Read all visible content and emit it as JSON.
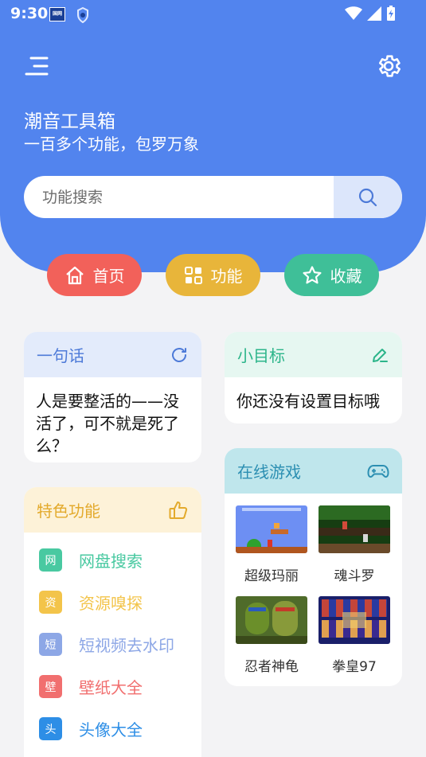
{
  "status": {
    "time": "9:30",
    "sim_label": "国网"
  },
  "header": {
    "title": "潮音工具箱",
    "subtitle": "一百多个功能，包罗万象"
  },
  "search": {
    "placeholder": "功能搜索"
  },
  "nav": [
    {
      "label": "首页",
      "icon": "home-icon",
      "color": "#f2615a"
    },
    {
      "label": "功能",
      "icon": "grid-icon",
      "color": "#e8b53a"
    },
    {
      "label": "收藏",
      "icon": "star-icon",
      "color": "#3fbf98"
    }
  ],
  "quote": {
    "title": "一句话",
    "text": "人是要整活的——没活了，可不就是死了么？",
    "accent": "#4d7ad8",
    "head_bg": "#e3ebfb"
  },
  "goal": {
    "title": "小目标",
    "text": "你还没有设置目标哦",
    "accent": "#2cb58a",
    "head_bg": "#e6f7f1"
  },
  "features": {
    "title": "特色功能",
    "accent": "#e3aa2c",
    "head_bg": "#fdf2d8",
    "items": [
      {
        "badge": "网",
        "label": "网盘搜索",
        "color": "#49c9a1"
      },
      {
        "badge": "资",
        "label": "资源嗅探",
        "color": "#f3c44a"
      },
      {
        "badge": "短",
        "label": "短视频去水印",
        "color": "#8da7e6"
      },
      {
        "badge": "壁",
        "label": "壁纸大全",
        "color": "#f16f6f"
      },
      {
        "badge": "头",
        "label": "头像大全",
        "color": "#2d8ee6"
      }
    ]
  },
  "games": {
    "title": "在线游戏",
    "accent": "#2c8fb2",
    "head_bg": "#bfe6ec",
    "items": [
      {
        "name": "超级玛丽"
      },
      {
        "name": "魂斗罗"
      },
      {
        "name": "忍者神龟"
      },
      {
        "name": "拳皇97"
      }
    ]
  }
}
